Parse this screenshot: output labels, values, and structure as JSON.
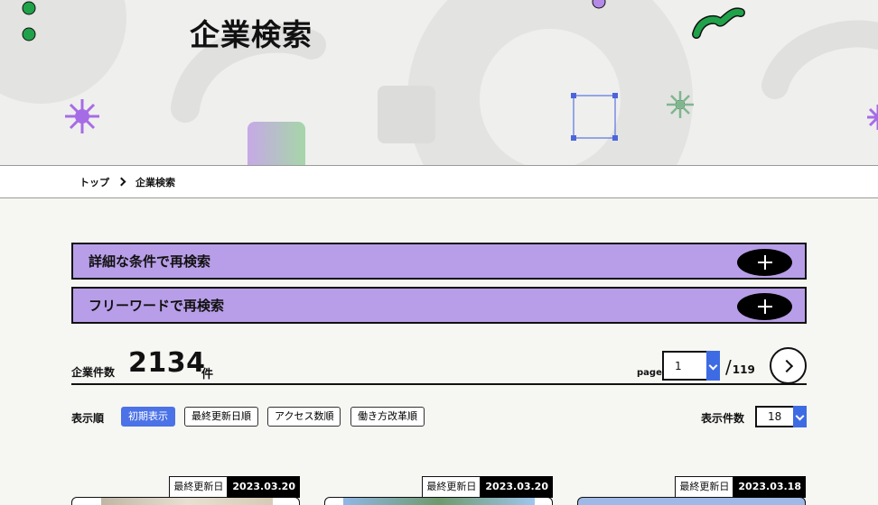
{
  "hero": {
    "title": "企業検索"
  },
  "breadcrumb": {
    "home": "トップ",
    "current": "企業検索"
  },
  "accordions": [
    {
      "label": "詳細な条件で再検索"
    },
    {
      "label": "フリーワードで再検索"
    }
  ],
  "results": {
    "count_label": "企業件数",
    "count": "2134",
    "count_unit": "件",
    "page_label": "page",
    "page_value": "1",
    "page_total": "119"
  },
  "sort": {
    "label": "表示順",
    "options": [
      "初期表示",
      "最終更新日順",
      "アクセス数順",
      "働き方改革順"
    ],
    "active": "初期表示"
  },
  "per_page": {
    "label": "表示件数",
    "value": "18"
  },
  "cards": [
    {
      "updated_label": "最終更新日",
      "updated_date": "2023.03.20"
    },
    {
      "updated_label": "最終更新日",
      "updated_date": "2023.03.20"
    },
    {
      "updated_label": "最終更新日",
      "updated_date": "2023.03.18"
    }
  ],
  "colors": {
    "accordion": "#b89ee8",
    "accent_blue": "#4b72e6",
    "green": "#1fa24a",
    "purple": "#a66ce6"
  }
}
